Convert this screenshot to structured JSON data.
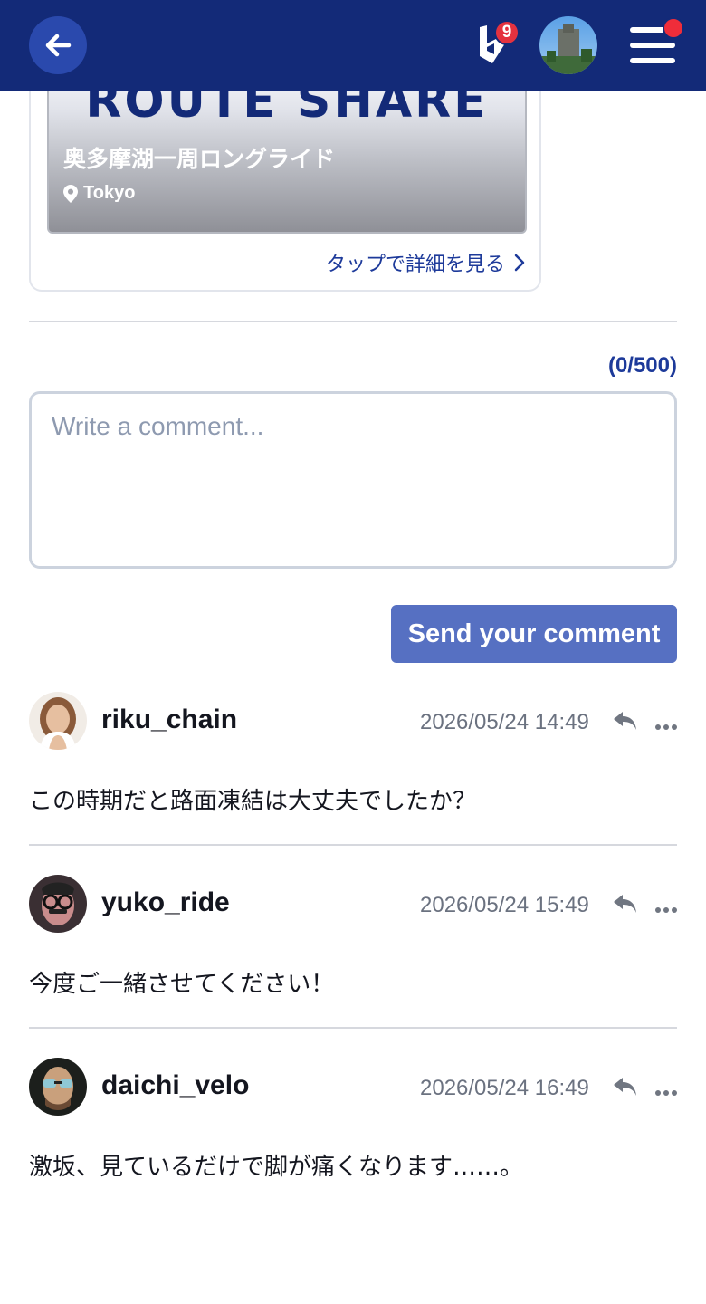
{
  "header": {
    "notification_count": "9",
    "icons": {
      "back": "arrow-left-icon",
      "brand": "brand-logo-icon",
      "menu": "hamburger-menu-icon"
    },
    "colors": {
      "bar": "#132a78",
      "badge": "#e4323f"
    }
  },
  "route_card": {
    "brand": "ROUTE SHARE",
    "title": "奥多摩湖一周ロングライド",
    "location": "Tokyo",
    "link_text": "タップで詳細を見る"
  },
  "comment_form": {
    "char_count": "(0/500)",
    "placeholder": "Write a comment...",
    "value": "",
    "submit_label": "Send your comment"
  },
  "comments": [
    {
      "user": "riku_chain",
      "time": "2026/05/24 14:49",
      "text": "この時期だと路面凍結は大丈夫でしたか？"
    },
    {
      "user": "yuko_ride",
      "time": "2026/05/24 15:49",
      "text": "今度ご一緒させてください！"
    },
    {
      "user": "daichi_velo",
      "time": "2026/05/24 16:49",
      "text": "激坂、見ているだけで脚が痛くなります……。"
    }
  ]
}
